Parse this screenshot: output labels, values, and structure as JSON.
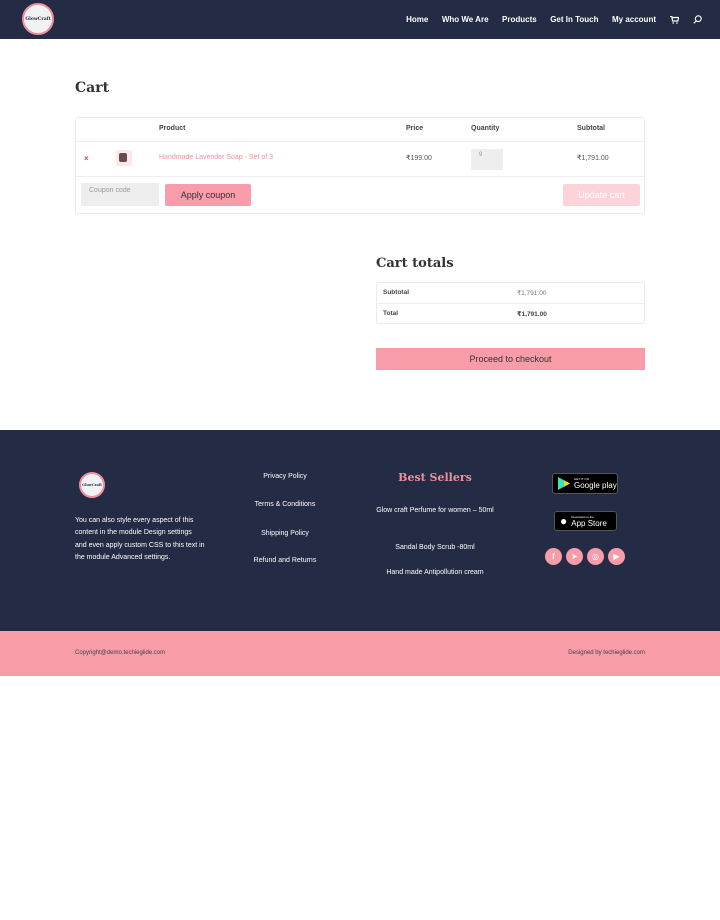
{
  "header": {
    "logo_text": "GlowCraft",
    "nav": [
      "Home",
      "Who We Are",
      "Products",
      "Get In Touch",
      "My account"
    ],
    "icons": [
      "cart-icon",
      "search-icon"
    ]
  },
  "page_title": "Cart",
  "cart": {
    "headers": {
      "product": "Product",
      "price": "Price",
      "quantity": "Quantity",
      "subtotal": "Subtotal"
    },
    "items": [
      {
        "remove": "×",
        "name": "Handmade Lavender Soap - Set of 3",
        "price": "₹199.00",
        "quantity": "9",
        "subtotal": "₹1,791.00"
      }
    ],
    "coupon_placeholder": "Coupon code",
    "apply_coupon": "Apply coupon",
    "update_cart": "Update cart"
  },
  "totals": {
    "title": "Cart totals",
    "subtotal_label": "Subtotal",
    "subtotal_value": "₹1,791.00",
    "total_label": "Total",
    "total_value": "₹1,791.00",
    "checkout": "Proceed to checkout"
  },
  "footer": {
    "logo_text": "GlowCraft",
    "about": "You can also style every aspect of this content in the module Design settings and even apply custom CSS to this text in the module Advanced settings.",
    "links": [
      "Privacy Policy",
      "Terms & Conditions",
      "Shipping Policy",
      "Refund and Returns"
    ],
    "best_sellers_title": "Best Sellers",
    "best_sellers": [
      "Glow craft Perfume for women – 50ml",
      "Sandal Body Scrub -80ml",
      "Hand made Antipollution cream"
    ],
    "google_play": {
      "small": "GET IT ON",
      "big": "Google play"
    },
    "app_store": {
      "small": "Download on the",
      "big": "App Store"
    },
    "social": [
      {
        "name": "facebook-icon",
        "glyph": "f"
      },
      {
        "name": "telegram-icon",
        "glyph": "➤"
      },
      {
        "name": "instagram-icon",
        "glyph": "◎"
      },
      {
        "name": "youtube-icon",
        "glyph": "▶"
      }
    ],
    "copyright": "Copyright@demo.techieglide.com",
    "designed_by": "Designed by techieglide.com"
  }
}
